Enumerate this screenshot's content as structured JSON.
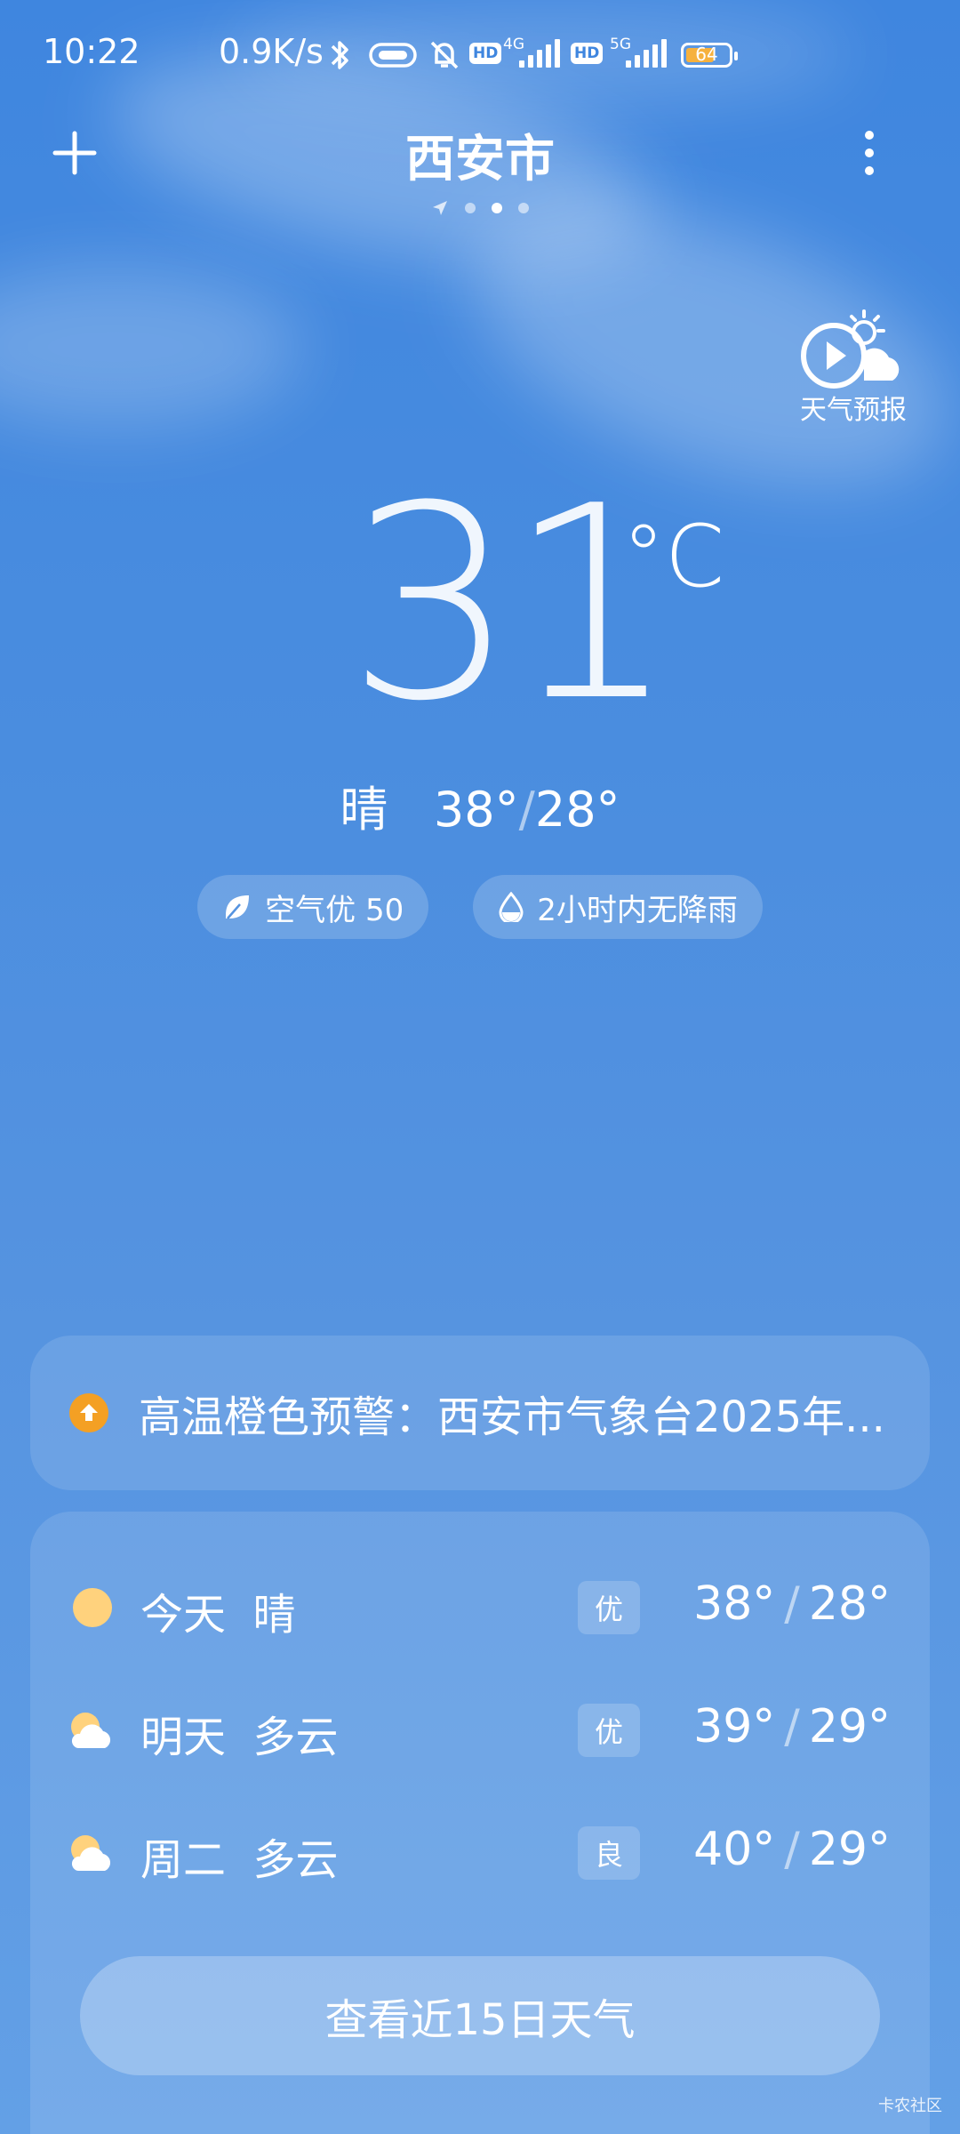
{
  "status_bar": {
    "time": "10:22",
    "speed": "0.9K/s",
    "hd1": "HD",
    "net1": "4G",
    "hd2": "HD",
    "net2": "5G",
    "battery": "64"
  },
  "header": {
    "city": "西安市",
    "page_dots": 3,
    "active_dot": 2
  },
  "forecast_video": {
    "label": "天气预报",
    "icon": "play-cloud-icon"
  },
  "current": {
    "temperature": "31",
    "unit": "°C",
    "condition": "晴",
    "high": "38°",
    "low": "28°",
    "slash": "/"
  },
  "pills": {
    "air": "空气优 50",
    "rain": "2小时内无降雨"
  },
  "alert": {
    "text": "高温橙色预警：西安市气象台2025年...",
    "color": "#f4a024"
  },
  "days": [
    {
      "day": "今天",
      "condition": "晴",
      "quality": "优",
      "high": "38°",
      "low": "28°",
      "icon": "sun-icon"
    },
    {
      "day": "明天",
      "condition": "多云",
      "quality": "优",
      "high": "39°",
      "low": "29°",
      "icon": "partly-cloudy-icon"
    },
    {
      "day": "周二",
      "condition": "多云",
      "quality": "良",
      "high": "40°",
      "low": "29°",
      "icon": "partly-cloudy-icon"
    }
  ],
  "view_15_days": "查看近15日天气",
  "watermark": "卡农社区"
}
